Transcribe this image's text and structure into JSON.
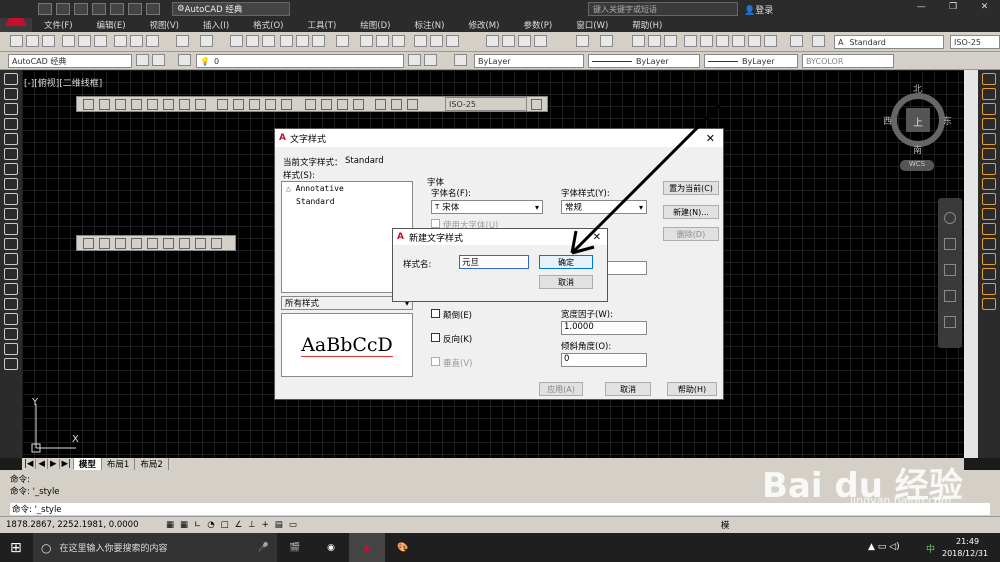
{
  "app": {
    "workspace": "AutoCAD 经典",
    "search_placeholder": "键入关键字或短语",
    "login": "登录"
  },
  "menu": [
    "文件(F)",
    "编辑(E)",
    "视图(V)",
    "插入(I)",
    "格式(O)",
    "工具(T)",
    "绘图(D)",
    "标注(N)",
    "修改(M)",
    "参数(P)",
    "窗口(W)",
    "帮助(H)"
  ],
  "toolbar": {
    "text_style": "Standard",
    "dim_style": "ISO-25",
    "workspace_combo": "AutoCAD 经典",
    "layer": "0",
    "color": "ByLayer",
    "linetype": "ByLayer",
    "lineweight": "ByLayer",
    "plotstyle": "BYCOLOR"
  },
  "float_toolbar_dim_style": "ISO-25",
  "viewport_label": "[-][俯视][二维线框]",
  "viewcube": {
    "n": "北",
    "s": "南",
    "e": "东",
    "w": "西",
    "top": "上",
    "wcs": "WCS"
  },
  "ucs": {
    "x": "X",
    "y": "Y"
  },
  "dialog": {
    "title": "文字样式",
    "current_style_label": "当前文字样式：",
    "current_style_value": "Standard",
    "styles_label": "样式(S):",
    "styles": [
      "Annotative",
      "Standard"
    ],
    "filter": "所有样式",
    "preview": "AaBbCcD",
    "font_group": "字体",
    "font_name_label": "字体名(F):",
    "font_name": "宋体",
    "font_style_label": "字体样式(Y):",
    "font_style": "常规",
    "bigfont": "使用大字体(U)",
    "set_current": "置为当前(C)",
    "new": "新建(N)...",
    "delete": "删除(D)",
    "upside_down": "颠倒(E)",
    "backwards": "反向(K)",
    "vertical": "垂直(V)",
    "width_factor_label": "宽度因子(W):",
    "width_factor": "1.0000",
    "oblique_label": "倾斜角度(O):",
    "oblique": "0",
    "apply": "应用(A)",
    "cancel": "取消",
    "help": "帮助(H)"
  },
  "new_style_dialog": {
    "title": "新建文字样式",
    "name_label": "样式名:",
    "name_value": "元旦",
    "ok": "确定",
    "cancel": "取消"
  },
  "tabs": [
    "模型",
    "布局1",
    "布局2"
  ],
  "command_lines": [
    "命令:",
    "命令: '_style",
    "命令: '_style"
  ],
  "coordinates": "1878.2867, 2252.1981, 0.0000",
  "status_right": "模",
  "taskbar": {
    "search_placeholder": "在这里输入你要搜索的内容",
    "time": "21:49",
    "date": "2018/12/31",
    "ime": "中"
  },
  "watermark": {
    "brand": "Bai du 经验",
    "url": "jingyan.baidu.com"
  }
}
